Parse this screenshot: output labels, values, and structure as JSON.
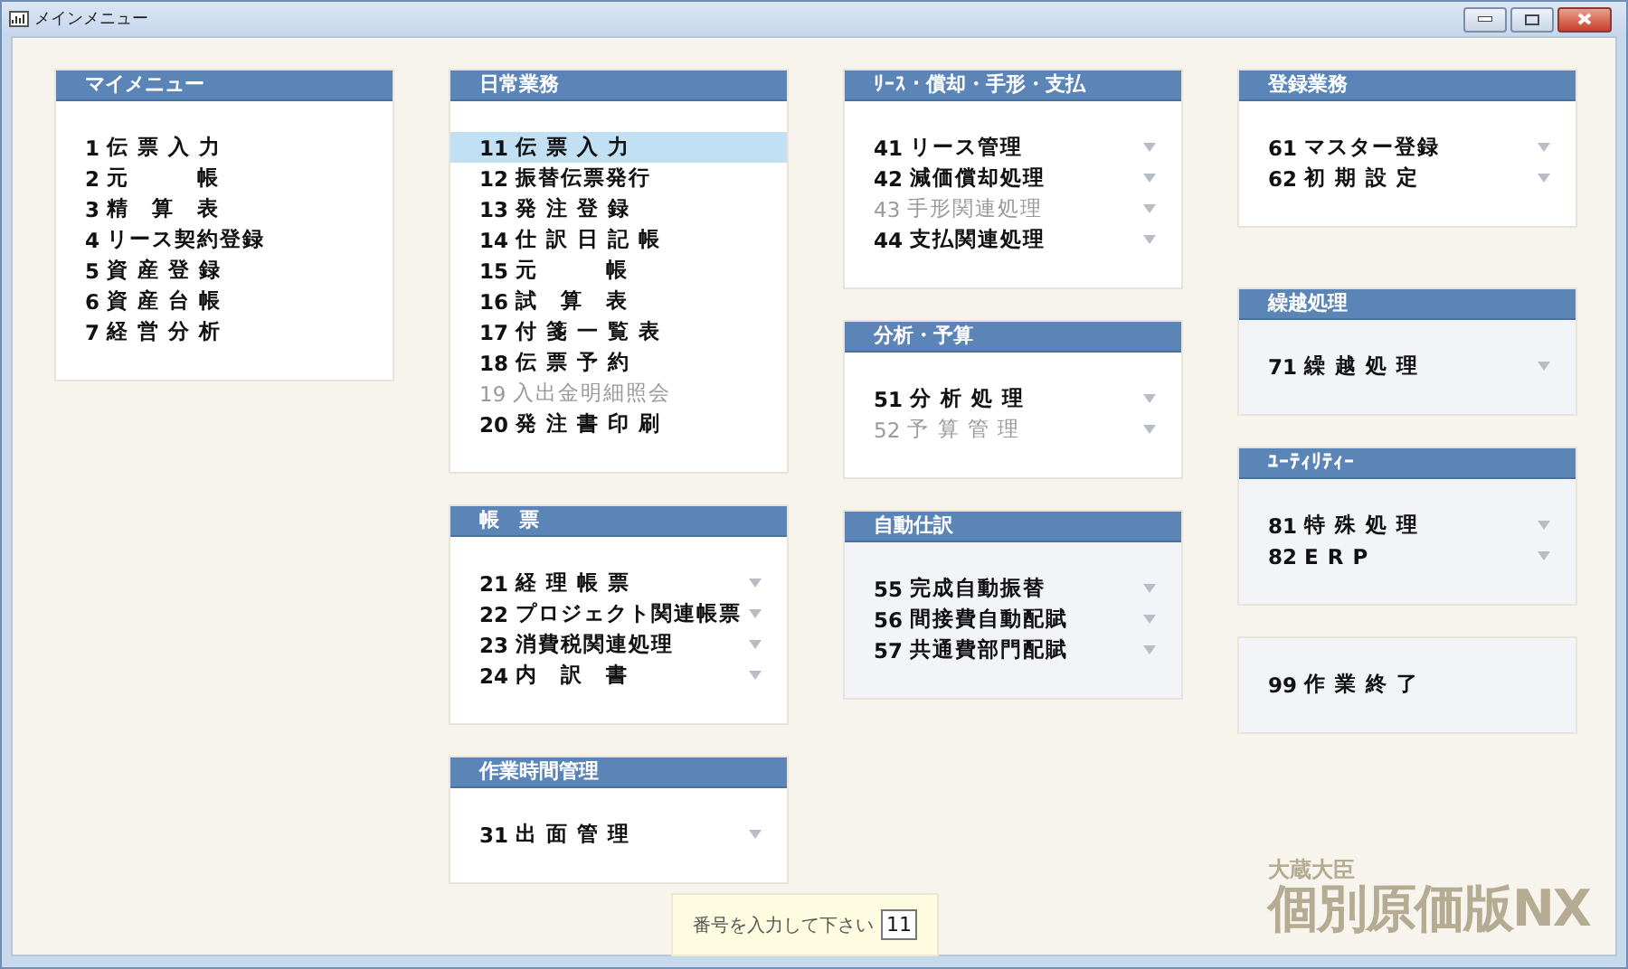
{
  "window": {
    "title": "メインメニュー"
  },
  "columns": [
    [
      {
        "title": "マイメニュー",
        "shaded": false,
        "items": [
          {
            "number": "1",
            "label": "伝 票 入 力",
            "submenu": false,
            "disabled": false,
            "selected": false
          },
          {
            "number": "2",
            "label": "元　　　帳",
            "submenu": false,
            "disabled": false,
            "selected": false
          },
          {
            "number": "3",
            "label": "精　算　表",
            "submenu": false,
            "disabled": false,
            "selected": false
          },
          {
            "number": "4",
            "label": "リース契約登録",
            "submenu": false,
            "disabled": false,
            "selected": false
          },
          {
            "number": "5",
            "label": "資 産 登 録",
            "submenu": false,
            "disabled": false,
            "selected": false
          },
          {
            "number": "6",
            "label": "資 産 台 帳",
            "submenu": false,
            "disabled": false,
            "selected": false
          },
          {
            "number": "7",
            "label": "経 営 分 析",
            "submenu": false,
            "disabled": false,
            "selected": false
          }
        ]
      }
    ],
    [
      {
        "title": "日常業務",
        "shaded": false,
        "items": [
          {
            "number": "11",
            "label": "伝 票 入 力",
            "submenu": false,
            "disabled": false,
            "selected": true
          },
          {
            "number": "12",
            "label": "振替伝票発行",
            "submenu": false,
            "disabled": false,
            "selected": false
          },
          {
            "number": "13",
            "label": "発 注 登 録",
            "submenu": false,
            "disabled": false,
            "selected": false
          },
          {
            "number": "14",
            "label": "仕 訳 日 記 帳",
            "submenu": false,
            "disabled": false,
            "selected": false
          },
          {
            "number": "15",
            "label": "元　　　帳",
            "submenu": false,
            "disabled": false,
            "selected": false
          },
          {
            "number": "16",
            "label": "試　算　表",
            "submenu": false,
            "disabled": false,
            "selected": false
          },
          {
            "number": "17",
            "label": "付 箋 一 覧 表",
            "submenu": false,
            "disabled": false,
            "selected": false
          },
          {
            "number": "18",
            "label": "伝 票 予 約",
            "submenu": false,
            "disabled": false,
            "selected": false
          },
          {
            "number": "19",
            "label": "入出金明細照会",
            "submenu": false,
            "disabled": true,
            "selected": false
          },
          {
            "number": "20",
            "label": "発 注 書 印 刷",
            "submenu": false,
            "disabled": false,
            "selected": false
          }
        ]
      },
      {
        "title": "帳　票",
        "shaded": false,
        "items": [
          {
            "number": "21",
            "label": "経 理 帳 票",
            "submenu": true,
            "disabled": false,
            "selected": false
          },
          {
            "number": "22",
            "label": "プロジェクト関連帳票",
            "submenu": true,
            "disabled": false,
            "selected": false
          },
          {
            "number": "23",
            "label": "消費税関連処理",
            "submenu": true,
            "disabled": false,
            "selected": false
          },
          {
            "number": "24",
            "label": "内　訳　書",
            "submenu": true,
            "disabled": false,
            "selected": false
          }
        ]
      },
      {
        "title": "作業時間管理",
        "shaded": false,
        "items": [
          {
            "number": "31",
            "label": "出 面 管 理",
            "submenu": true,
            "disabled": false,
            "selected": false
          }
        ]
      }
    ],
    [
      {
        "title": "ﾘｰｽ・償却・手形・支払",
        "shaded": false,
        "items": [
          {
            "number": "41",
            "label": "リース管理",
            "submenu": true,
            "disabled": false,
            "selected": false
          },
          {
            "number": "42",
            "label": "減価償却処理",
            "submenu": true,
            "disabled": false,
            "selected": false
          },
          {
            "number": "43",
            "label": "手形関連処理",
            "submenu": true,
            "disabled": true,
            "selected": false
          },
          {
            "number": "44",
            "label": "支払関連処理",
            "submenu": true,
            "disabled": false,
            "selected": false
          }
        ]
      },
      {
        "title": "分析・予算",
        "shaded": false,
        "items": [
          {
            "number": "51",
            "label": "分 析 処 理",
            "submenu": true,
            "disabled": false,
            "selected": false
          },
          {
            "number": "52",
            "label": "予 算 管 理",
            "submenu": true,
            "disabled": true,
            "selected": false
          }
        ]
      },
      {
        "title": "自動仕訳",
        "shaded": true,
        "items": [
          {
            "number": "55",
            "label": "完成自動振替",
            "submenu": true,
            "disabled": false,
            "selected": false
          },
          {
            "number": "56",
            "label": "間接費自動配賦",
            "submenu": true,
            "disabled": false,
            "selected": false
          },
          {
            "number": "57",
            "label": "共通費部門配賦",
            "submenu": true,
            "disabled": false,
            "selected": false
          }
        ]
      }
    ],
    [
      {
        "title": "登録業務",
        "shaded": false,
        "items": [
          {
            "number": "61",
            "label": "マスター登録",
            "submenu": true,
            "disabled": false,
            "selected": false
          },
          {
            "number": "62",
            "label": "初 期 設 定",
            "submenu": true,
            "disabled": false,
            "selected": false
          }
        ]
      },
      {
        "title": "繰越処理",
        "shaded": true,
        "items": [
          {
            "number": "71",
            "label": "繰 越 処 理",
            "submenu": true,
            "disabled": false,
            "selected": false
          }
        ]
      },
      {
        "title": "ﾕｰﾃｨﾘﾃｨｰ",
        "shaded": true,
        "items": [
          {
            "number": "81",
            "label": "特 殊 処 理",
            "submenu": true,
            "disabled": false,
            "selected": false
          },
          {
            "number": "82",
            "label": "E R P",
            "submenu": true,
            "disabled": false,
            "selected": false
          }
        ]
      },
      {
        "shaded": true,
        "items": [
          {
            "number": "99",
            "label": "作 業 終 了",
            "submenu": false,
            "disabled": false,
            "selected": false
          }
        ]
      }
    ]
  ],
  "prompt": {
    "label": "番号を入力して下さい",
    "value": "11"
  },
  "logo": {
    "subtitle": "大蔵大臣",
    "title": "個別原価版NX"
  }
}
